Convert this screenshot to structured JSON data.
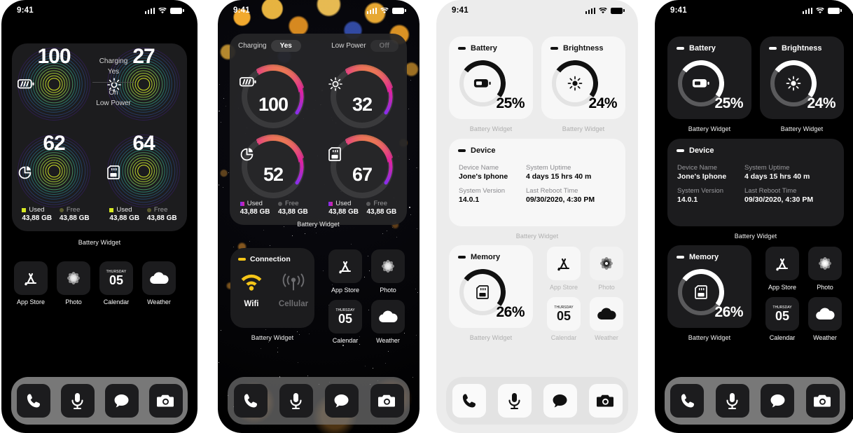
{
  "status_bar": {
    "time": "9:41",
    "signal_icon": "cellular-signal-icon",
    "wifi_icon": "wifi-icon",
    "battery_icon": "battery-icon"
  },
  "phone1": {
    "theme": "dark",
    "widget_label": "Battery Widget",
    "rings": [
      {
        "value": "100",
        "icon": "battery-charging-icon",
        "name": "battery"
      },
      {
        "value": "27",
        "icon": "brightness-sun-icon",
        "name": "brightness"
      },
      {
        "value": "62",
        "icon": "pie-chart-icon",
        "name": "storage"
      },
      {
        "value": "64",
        "icon": "memory-card-icon",
        "name": "memory"
      }
    ],
    "center": {
      "charging_label": "Charging",
      "charging_value": "Yes",
      "lowpower_value": "On",
      "lowpower_label": "Low Power"
    },
    "legends": [
      {
        "used_label": "Used",
        "used_value": "43,88 GB",
        "free_label": "Free",
        "free_value": "43,88 GB"
      },
      {
        "used_label": "Used",
        "used_value": "43,88 GB",
        "free_label": "Free",
        "free_value": "43,88 GB"
      }
    ],
    "apps": [
      {
        "label": "App Store",
        "icon": "app-store-icon"
      },
      {
        "label": "Photo",
        "icon": "photos-icon"
      },
      {
        "label": "Calendar",
        "icon": "calendar-icon",
        "weekday": "THURSDAY",
        "day": "05"
      },
      {
        "label": "Weather",
        "icon": "weather-cloud-icon"
      }
    ],
    "dock": [
      {
        "icon": "phone-icon"
      },
      {
        "icon": "microphone-icon"
      },
      {
        "icon": "messages-icon"
      },
      {
        "icon": "camera-icon"
      }
    ]
  },
  "phone2": {
    "theme": "dark",
    "widget_label": "Battery Widget",
    "toggles": [
      {
        "label": "Charging",
        "value": "Yes",
        "state": "on"
      },
      {
        "label": "Low Power",
        "value": "Off",
        "state": "off"
      }
    ],
    "rings": [
      {
        "value": "100",
        "icon": "battery-charging-icon",
        "name": "battery"
      },
      {
        "value": "32",
        "icon": "brightness-sun-icon",
        "name": "brightness"
      },
      {
        "value": "52",
        "icon": "pie-chart-icon",
        "name": "storage"
      },
      {
        "value": "67",
        "icon": "memory-card-icon",
        "name": "memory"
      }
    ],
    "legends": [
      {
        "used_label": "Used",
        "used_value": "43,88 GB",
        "free_label": "Free",
        "free_value": "43,88 GB"
      },
      {
        "used_label": "Used",
        "used_value": "43,88 GB",
        "free_label": "Free",
        "free_value": "43,88 GB"
      }
    ],
    "connection": {
      "title": "Connection",
      "label_wifi": "Wifi",
      "label_cellular": "Cellular",
      "active": "Wifi",
      "widget_label": "Battery Widget",
      "accent": "#F5C518"
    },
    "apps": [
      {
        "label": "App Store",
        "icon": "app-store-icon"
      },
      {
        "label": "Photo",
        "icon": "photos-icon"
      },
      {
        "label": "Calendar",
        "icon": "calendar-icon",
        "weekday": "THURSDAY",
        "day": "05"
      },
      {
        "label": "Weather",
        "icon": "weather-cloud-icon"
      }
    ],
    "dock": [
      {
        "icon": "phone-icon"
      },
      {
        "icon": "microphone-icon"
      },
      {
        "icon": "messages-icon"
      },
      {
        "icon": "camera-icon"
      }
    ]
  },
  "phone3": {
    "theme": "light",
    "gauges": [
      {
        "title": "Battery",
        "percent": "25%",
        "value": 25,
        "icon": "battery-icon",
        "widget_label": "Battery Widget"
      },
      {
        "title": "Brightness",
        "percent": "24%",
        "value": 24,
        "icon": "brightness-sun-icon",
        "widget_label": "Battery Widget"
      }
    ],
    "device": {
      "title": "Device",
      "widget_label": "Battery Widget",
      "fields": [
        {
          "key": "Device Name",
          "value": "Jone's Iphone"
        },
        {
          "key": "System Uptime",
          "value": "4 days 15 hrs 40 m"
        },
        {
          "key": "System Version",
          "value": "14.0.1"
        },
        {
          "key": "Last Reboot Time",
          "value": "09/30/2020, 4:30 PM"
        }
      ]
    },
    "memory": {
      "title": "Memory",
      "percent": "26%",
      "value": 26,
      "icon": "memory-card-icon",
      "widget_label": "Battery Widget"
    },
    "apps": [
      {
        "label": "App Store",
        "icon": "app-store-icon"
      },
      {
        "label": "Photo",
        "icon": "photos-icon"
      },
      {
        "label": "Calendar",
        "icon": "calendar-icon",
        "weekday": "THURSDAY",
        "day": "05"
      },
      {
        "label": "Weather",
        "icon": "weather-cloud-icon"
      }
    ],
    "dock": [
      {
        "icon": "phone-icon"
      },
      {
        "icon": "microphone-icon"
      },
      {
        "icon": "messages-icon"
      },
      {
        "icon": "camera-icon"
      }
    ]
  },
  "phone4": {
    "theme": "dark",
    "gauges": [
      {
        "title": "Battery",
        "percent": "25%",
        "value": 25,
        "icon": "battery-icon",
        "widget_label": "Battery Widget"
      },
      {
        "title": "Brightness",
        "percent": "24%",
        "value": 24,
        "icon": "brightness-sun-icon",
        "widget_label": "Battery Widget"
      }
    ],
    "device": {
      "title": "Device",
      "widget_label": "Battery Widget",
      "fields": [
        {
          "key": "Device Name",
          "value": "Jone's Iphone"
        },
        {
          "key": "System Uptime",
          "value": "4 days 15 hrs 40 m"
        },
        {
          "key": "System Version",
          "value": "14.0.1"
        },
        {
          "key": "Last Reboot Time",
          "value": "09/30/2020, 4:30 PM"
        }
      ]
    },
    "memory": {
      "title": "Memory",
      "percent": "26%",
      "value": 26,
      "icon": "memory-card-icon",
      "widget_label": "Battery Widget"
    },
    "apps": [
      {
        "label": "App Store",
        "icon": "app-store-icon"
      },
      {
        "label": "Photo",
        "icon": "photos-icon"
      },
      {
        "label": "Calendar",
        "icon": "calendar-icon",
        "weekday": "THURSDAY",
        "day": "05"
      },
      {
        "label": "Weather",
        "icon": "weather-cloud-icon"
      }
    ],
    "dock": [
      {
        "icon": "phone-icon"
      },
      {
        "icon": "microphone-icon"
      },
      {
        "icon": "messages-icon"
      },
      {
        "icon": "camera-icon"
      }
    ]
  },
  "colors": {
    "neon_yellow": "#D6E823",
    "neon_teal": "#2E9E8F",
    "neon_purple": "#5B3A9E",
    "rainbow_blue": "#2563E6",
    "rainbow_magenta": "#E0239B",
    "rainbow_yellow": "#F5B91E",
    "accent_yellow": "#F5C518",
    "dark_card": "#1C1C1E",
    "light_card": "#F7F7F7"
  }
}
